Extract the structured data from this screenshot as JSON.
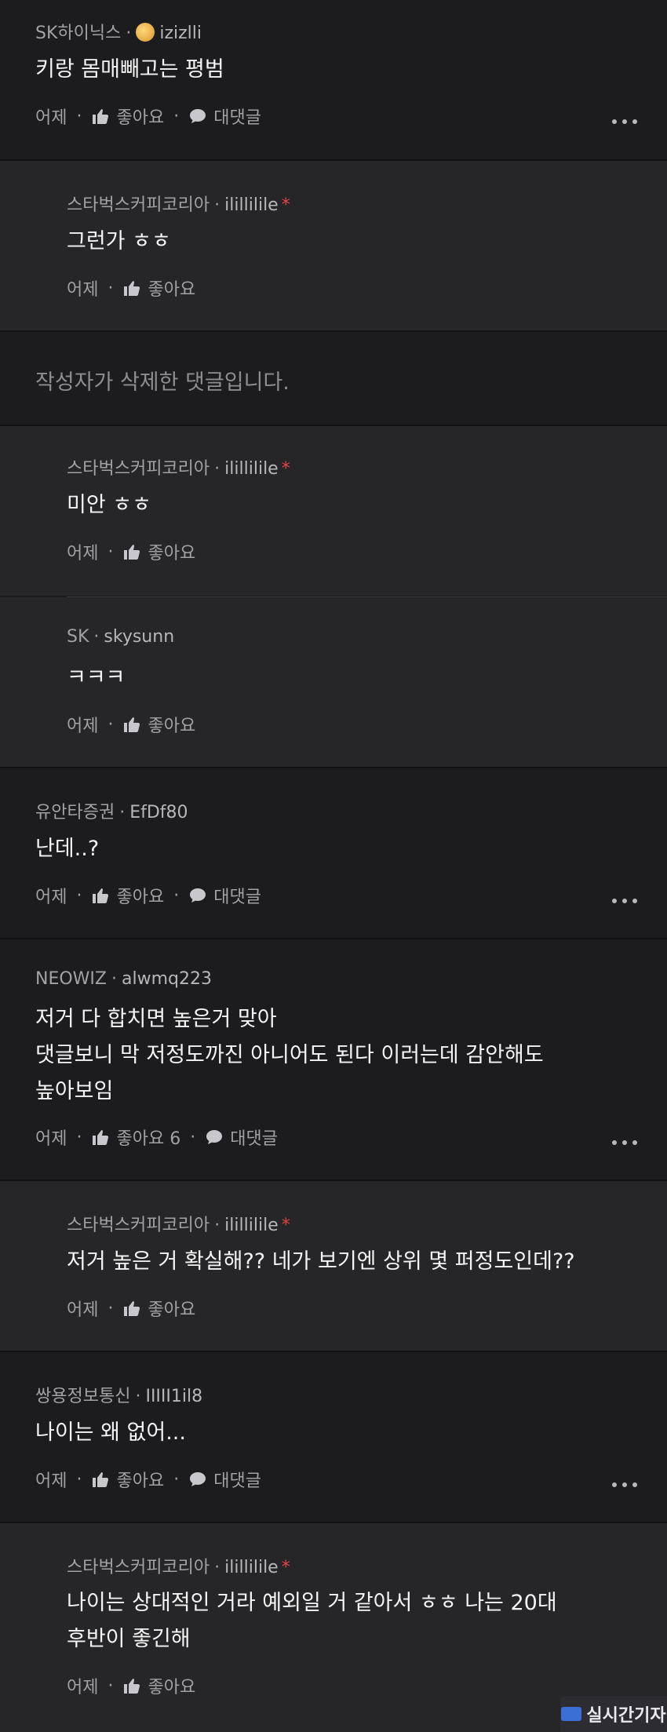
{
  "comments": [
    {
      "company": "SK하이닉스",
      "user": "izizlli",
      "text": "키랑 몸매빼고는 평범",
      "time": "어제",
      "like": "좋아요",
      "reply": "대댓글"
    },
    {
      "company": "스타벅스커피코리아",
      "user": "ilillilile",
      "star": "*",
      "text": "그런가 ㅎㅎ",
      "time": "어제",
      "like": "좋아요"
    },
    {
      "deleted": "작성자가 삭제한 댓글입니다."
    },
    {
      "company": "스타벅스커피코리아",
      "user": "ilillilile",
      "star": "*",
      "text": "미안 ㅎㅎ",
      "time": "어제",
      "like": "좋아요"
    },
    {
      "company": "SK",
      "user": "skysunn",
      "text": "ㅋㅋㅋ",
      "time": "어제",
      "like": "좋아요"
    },
    {
      "company": "유안타증권",
      "user": "EfDf80",
      "text": "난데..?",
      "time": "어제",
      "like": "좋아요",
      "reply": "대댓글"
    },
    {
      "company": "NEOWIZ",
      "user": "alwmq223",
      "lines": [
        "저거 다 합치면 높은거 맞아",
        "댓글보니 막 저정도까진 아니어도 된다 이러는데 감안해도",
        "높아보임"
      ],
      "time": "어제",
      "like": "좋아요 6",
      "reply": "대댓글"
    },
    {
      "company": "스타벅스커피코리아",
      "user": "ilillilile",
      "star": "*",
      "text": "저거 높은 거 확실해?? 네가 보기엔 상위 몇 퍼정도인데??",
      "time": "어제",
      "like": "좋아요"
    },
    {
      "company": "쌍용정보통신",
      "user": "IIIII1il8",
      "text": "나이는 왜 없어...",
      "time": "어제",
      "like": "좋아요",
      "reply": "대댓글"
    },
    {
      "company": "스타벅스커피코리아",
      "user": "ilillilile",
      "star": "*",
      "lines": [
        "나이는 상대적인 거라 예외일 거 같아서 ㅎㅎ 나는 20대",
        "후반이 좋긴해"
      ],
      "time": "어제",
      "like": "좋아요"
    }
  ],
  "watermark": "실시간기자",
  "colors": {
    "background": "#1c1c1e",
    "reply_background": "#262628",
    "star": "#e0463c"
  }
}
